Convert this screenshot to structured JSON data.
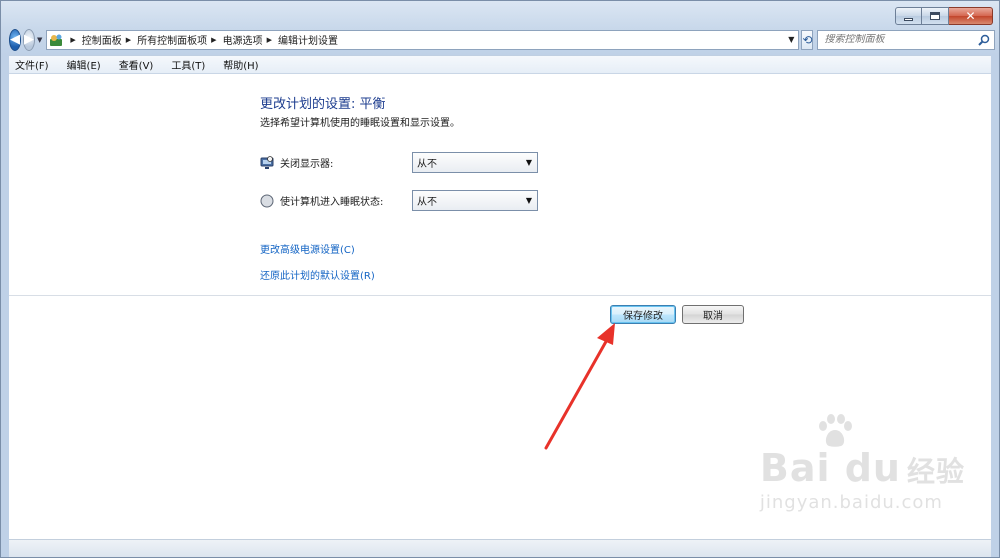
{
  "window": {
    "caption_buttons": [
      "minimize",
      "maximize",
      "close"
    ]
  },
  "address_bar": {
    "breadcrumbs": [
      "控制面板",
      "所有控制面板项",
      "电源选项",
      "编辑计划设置"
    ]
  },
  "search": {
    "placeholder": "搜索控制面板"
  },
  "menu": {
    "items": [
      "文件(F)",
      "编辑(E)",
      "查看(V)",
      "工具(T)",
      "帮助(H)"
    ]
  },
  "main": {
    "title": "更改计划的设置: 平衡",
    "subtitle": "选择希望计算机使用的睡眠设置和显示设置。",
    "settings": [
      {
        "label": "关闭显示器:",
        "value": "从不",
        "icon": "display-icon"
      },
      {
        "label": "使计算机进入睡眠状态:",
        "value": "从不",
        "icon": "sleep-moon-icon"
      }
    ],
    "links": [
      "更改高级电源设置(C)",
      "还原此计划的默认设置(R)"
    ],
    "buttons": {
      "save": "保存修改",
      "cancel": "取消"
    }
  },
  "watermark": {
    "main": "Bai du",
    "cn": "经验",
    "sub": "jingyan.baidu.com"
  },
  "colors": {
    "title": "#1d3d8f",
    "link": "#1364c4",
    "arrow": "#e8322a"
  }
}
